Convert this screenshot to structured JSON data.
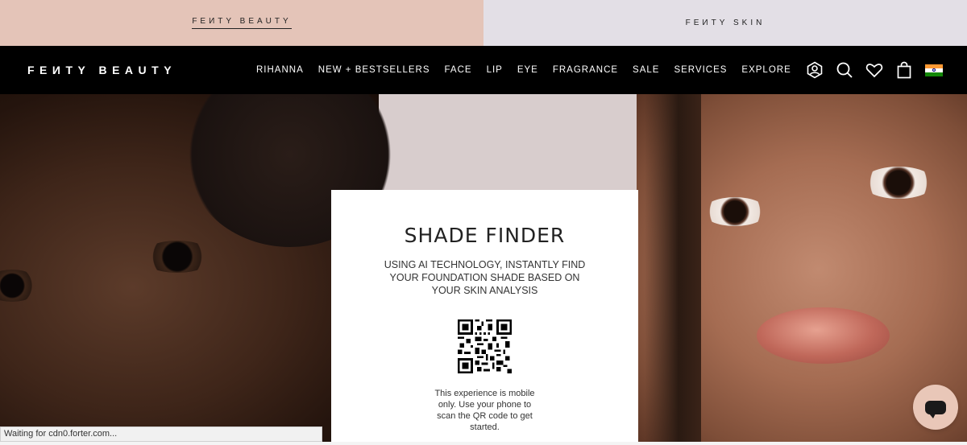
{
  "brand_tabs": [
    {
      "label": "FEИTY BEAUTY",
      "active": true
    },
    {
      "label": "FEИTY SKIN",
      "active": false
    }
  ],
  "nav": {
    "logo": "FEИTY BEAUTY",
    "menu": [
      "RIHANNA",
      "NEW + BESTSELLERS",
      "FACE",
      "LIP",
      "EYE",
      "FRAGRANCE",
      "SALE",
      "SERVICES",
      "EXPLORE"
    ],
    "icons": [
      "account-icon",
      "search-icon",
      "heart-icon",
      "bag-icon",
      "india-flag-icon"
    ]
  },
  "card": {
    "title": "SHADE FINDER",
    "description": "Using AI technology, instantly find your foundation shade based on your skin analysis",
    "note": "This experience is mobile only. Use your phone to scan the QR code to get started."
  },
  "status_bar": "Waiting for cdn0.forter.com...",
  "colors": {
    "beauty_tab_bg": "#e4c4b8",
    "skin_tab_bg": "#e3dfe6",
    "nav_bg": "#000000",
    "chat_button_bg": "#e9c7b8"
  }
}
